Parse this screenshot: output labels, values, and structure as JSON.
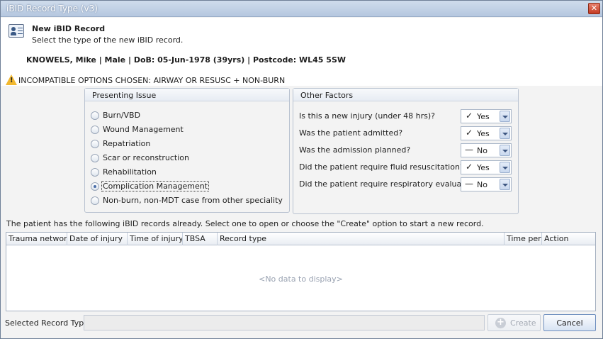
{
  "window": {
    "title": "iBID Record Type (v3)"
  },
  "header": {
    "title": "New iBID Record",
    "subtitle": "Select the type of the new iBID record.",
    "patient": "KNOWELS, Mike | Male | DoB: 05-Jun-1978 (39yrs) | Postcode: WL45 5SW"
  },
  "warning": {
    "text": "INCOMPATIBLE OPTIONS CHOSEN: AIRWAY OR RESUSC + NON-BURN"
  },
  "presenting": {
    "title": "Presenting Issue",
    "options": [
      {
        "label": "Burn/VBD",
        "checked": false
      },
      {
        "label": "Wound Management",
        "checked": false
      },
      {
        "label": "Repatriation",
        "checked": false
      },
      {
        "label": "Scar or reconstruction",
        "checked": false
      },
      {
        "label": "Rehabilitation",
        "checked": false
      },
      {
        "label": "Complication Management",
        "checked": true
      },
      {
        "label": "Non-burn, non-MDT case from other speciality",
        "checked": false
      }
    ]
  },
  "other": {
    "title": "Other Factors",
    "factors": [
      {
        "label": "Is this a new injury (under 48 hrs)?",
        "value": "Yes",
        "mark": "✓"
      },
      {
        "label": "Was the patient admitted?",
        "value": "Yes",
        "mark": "✓"
      },
      {
        "label": "Was the admission planned?",
        "value": "No",
        "mark": "—"
      },
      {
        "label": "Did the patient require fluid resuscitation?",
        "value": "Yes",
        "mark": "✓"
      },
      {
        "label": "Did the patient require respiratory evaluation?",
        "value": "No",
        "mark": "—"
      }
    ]
  },
  "records": {
    "info": "The patient has the following iBID records already.  Select one to open or choose the \"Create\" option to start a new record.",
    "columns": [
      "Trauma network",
      "Date of injury",
      "Time of injury",
      "TBSA",
      "Record type",
      "Time perio",
      "Action"
    ],
    "empty": "<No data to display>"
  },
  "footer": {
    "selected_label": "Selected Record Type",
    "selected_value": "",
    "create_label": "Create",
    "cancel_label": "Cancel"
  },
  "icons": {
    "record": "record-card-icon",
    "warning": "warning-icon",
    "create": "plus-circle-icon",
    "close": "close-icon"
  }
}
